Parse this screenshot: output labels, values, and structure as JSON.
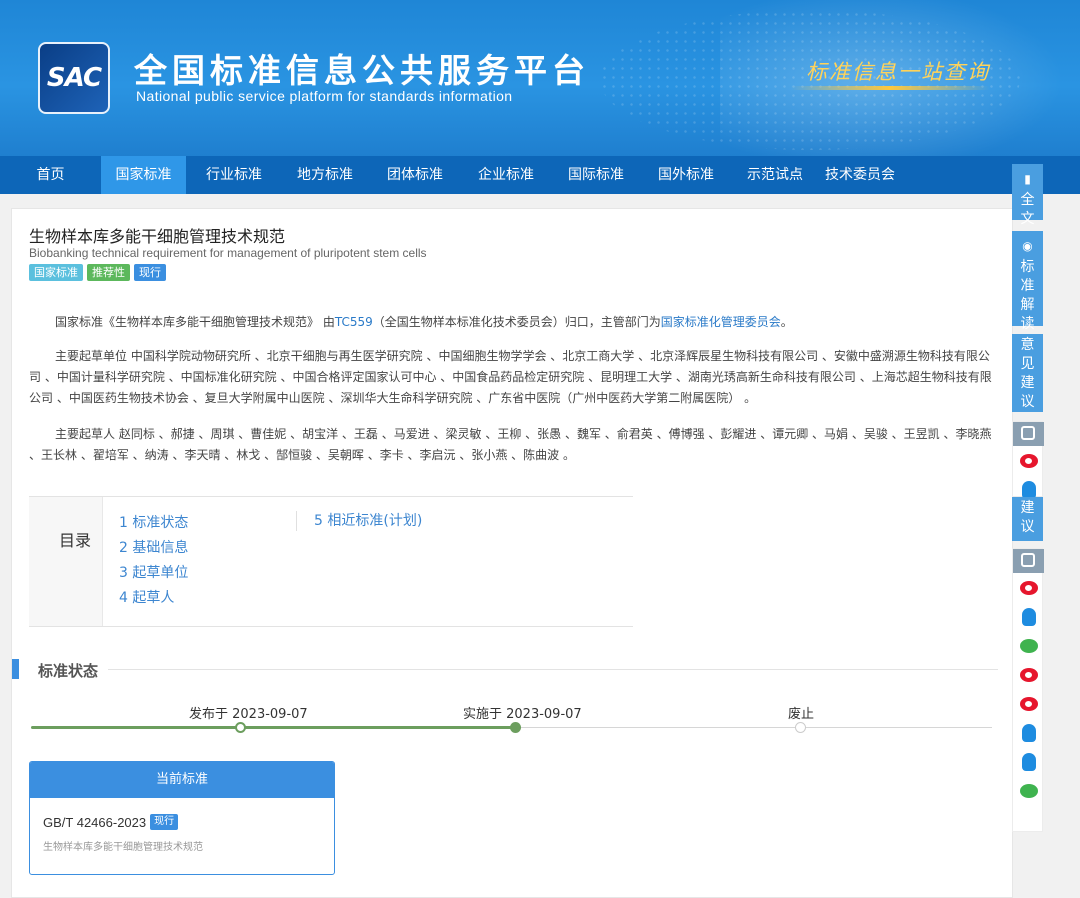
{
  "header": {
    "logo_text": "SAC",
    "title": "全国标准信息公共服务平台",
    "subtitle": "National public service platform  for standards information",
    "slogan": "标准信息一站查询"
  },
  "nav": {
    "items": [
      "首页",
      "国家标准",
      "行业标准",
      "地方标准",
      "团体标准",
      "企业标准",
      "国际标准",
      "国外标准",
      "示范试点",
      "技术委员会"
    ],
    "active_index": 1
  },
  "doc": {
    "title": "生物样本库多能干细胞管理技术规范",
    "title_en": "Biobanking technical requirement for management of pluripotent stem cells",
    "badges": [
      "国家标准",
      "推荐性",
      "现行"
    ],
    "intro_prefix": "国家标准《生物样本库多能干细胞管理技术规范》 由",
    "tc_link": "TC559",
    "intro_mid": "（全国生物样本标准化技术委员会）归口，主管部门为",
    "dept_link": "国家标准化管理委员会",
    "intro_suffix": "。",
    "drafting_units": "主要起草单位 中国科学院动物研究所 、北京干细胞与再生医学研究院 、中国细胞生物学学会 、北京工商大学 、北京泽辉辰星生物科技有限公司 、安徽中盛溯源生物科技有限公司 、中国计量科学研究院 、中国标准化研究院 、中国合格评定国家认可中心 、中国食品药品检定研究院 、昆明理工大学 、湖南光琇高新生命科技有限公司 、上海芯超生物科技有限公司 、中国医药生物技术协会 、复旦大学附属中山医院 、深圳华大生命科学研究院 、广东省中医院（广州中医药大学第二附属医院） 。",
    "drafters": "主要起草人 赵同标 、郝捷 、周琪 、曹佳妮 、胡宝洋 、王磊 、马爱进 、梁灵敏 、王柳 、张愚 、魏军 、俞君英 、傅博强 、彭耀进 、谭元卿 、马娟 、吴骏 、王昱凯 、李晓燕 、王长林 、翟培军 、纳涛 、李天晴 、林戈 、郜恒骏 、吴朝晖 、李卡 、李启沅 、张小燕 、陈曲波 。"
  },
  "toc": {
    "label": "目录",
    "items": [
      "1  标准状态",
      "2  基础信息",
      "3  起草单位",
      "4  起草人"
    ],
    "items_col2": [
      "5  相近标准(计划)"
    ]
  },
  "status": {
    "section_title": "标准状态",
    "timeline": [
      "发布于 2023-09-07",
      "实施于 2023-09-07",
      "废止"
    ],
    "current_header": "当前标准",
    "current_code": "GB/T 42466-2023",
    "current_badge": "现行",
    "current_name": "生物样本库多能干细胞管理技术规范"
  },
  "sidebar": {
    "full_text": "全文",
    "interpret": "标准解读",
    "feedback": "意见建议",
    "feedback_tail": "建议"
  },
  "colors": {
    "header_blue": "#2a94e2",
    "nav_blue": "#0d66b8",
    "accent": "#3b8fe0",
    "timeline_green": "#6c9e5e"
  }
}
